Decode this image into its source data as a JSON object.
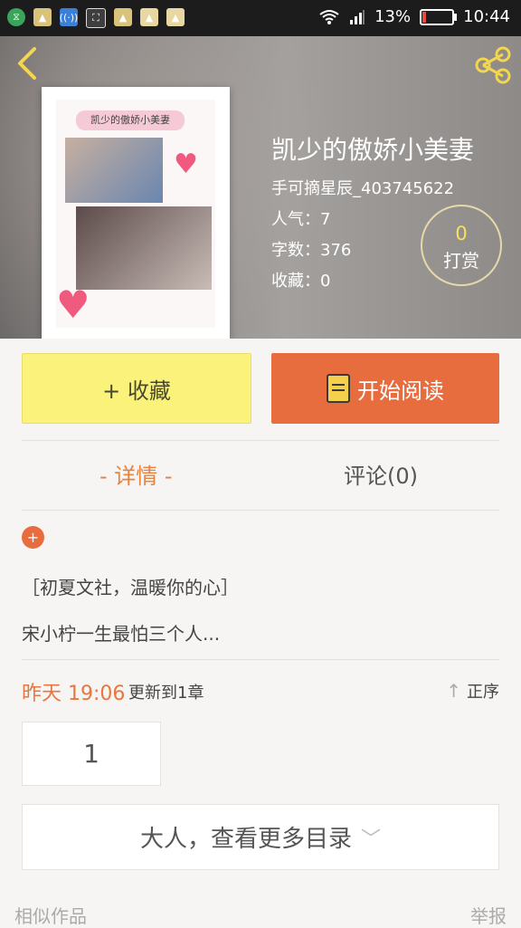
{
  "status_bar": {
    "battery": "13%",
    "time": "10:44"
  },
  "book": {
    "cover_title": "凯少的傲娇小美妻",
    "title": "凯少的傲娇小美妻",
    "author": "手可摘星辰_403745622",
    "popularity_label": "人气：7",
    "word_count_label": "字数：376",
    "favorites_label": "收藏：0",
    "tip_count": "0",
    "tip_label": "打赏"
  },
  "actions": {
    "favorite_label": "+ 收藏",
    "read_label": "开始阅读"
  },
  "tabs": {
    "details": "- 详情 -",
    "comments": "评论(0)"
  },
  "intro": {
    "plus": "+",
    "line1": "［初夏文社，温暖你的心］",
    "line2": "宋小柠一生最怕三个人..."
  },
  "update": {
    "time": "昨天 19:06",
    "text": "更新到1章",
    "sort_label": "正序"
  },
  "chapters": {
    "first": "1",
    "more_label": "大人，查看更多目录"
  },
  "footer": {
    "similar": "相似作品",
    "report": "举报"
  },
  "colors": {
    "accent_orange": "#e76c3e",
    "favorite_yellow": "#fbf27b",
    "tip_number": "#f7e15f"
  }
}
